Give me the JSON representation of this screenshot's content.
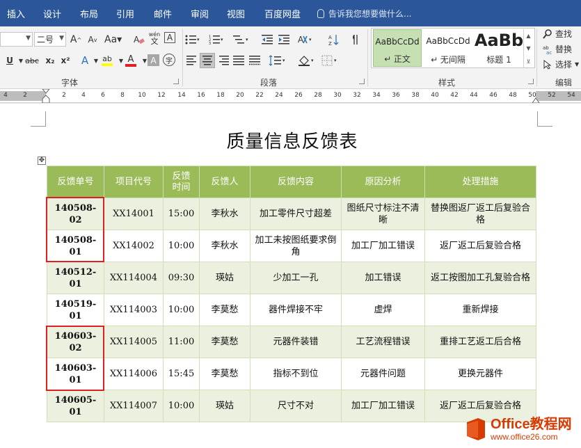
{
  "ribbon_tabs": [
    "插入",
    "设计",
    "布局",
    "引用",
    "邮件",
    "审阅",
    "视图",
    "百度网盘"
  ],
  "tell_me": "告诉我您想要做什么...",
  "font": {
    "size_value": "二号",
    "grow_label": "A",
    "shrink_label": "A",
    "underline": "U",
    "strike": "abc",
    "subscript": "x₂",
    "superscript": "x²",
    "text_effect": "A",
    "highlight": "ab",
    "font_color": "A",
    "char_shade": "A",
    "enclose": "字",
    "phonetic": "wén",
    "border_char": "A",
    "group_label": "字体"
  },
  "paragraph": {
    "group_label": "段落"
  },
  "styles": {
    "items": [
      {
        "sample": "AaBbCcDd",
        "name": "↵ 正文"
      },
      {
        "sample": "AaBbCcDd",
        "name": "↵ 无间隔"
      },
      {
        "sample": "AaBb",
        "name": "标题 1"
      }
    ],
    "group_label": "样式"
  },
  "editing": {
    "find": "查找",
    "replace": "替换",
    "select": "选择",
    "group_label": "编辑"
  },
  "ruler_numbers": [
    "4",
    "2",
    "2",
    "4",
    "6",
    "8",
    "10",
    "12",
    "14",
    "16",
    "18",
    "20",
    "22",
    "24",
    "26",
    "28",
    "30",
    "32",
    "34",
    "36",
    "38",
    "40",
    "42",
    "44",
    "46",
    "48",
    "50",
    "52",
    "54"
  ],
  "document": {
    "title": "质量信息反馈表",
    "table": {
      "headers": [
        "反馈单号",
        "项目代号",
        "反馈\n时间",
        "反馈人",
        "反馈内容",
        "原因分析",
        "处理措施"
      ],
      "rows": [
        [
          "140508-02",
          "XX14001",
          "15:00",
          "李秋水",
          "加工零件尺寸超差",
          "图纸尺寸标注不清晰",
          "替换图返厂返工后复验合格"
        ],
        [
          "140508-01",
          "XX14002",
          "10:00",
          "李秋水",
          "加工未按图纸要求倒角",
          "加工厂加工错误",
          "返厂返工后复验合格"
        ],
        [
          "140512-01",
          "XX114004",
          "09:30",
          "瑛姑",
          "少加工一孔",
          "加工错误",
          "返工按图加工孔复验合格"
        ],
        [
          "140519-01",
          "XX114003",
          "10:00",
          "李莫愁",
          "器件焊接不牢",
          "虚焊",
          "重新焊接"
        ],
        [
          "140603-02",
          "XX114005",
          "11:00",
          "李莫愁",
          "元器件装错",
          "工艺流程错误",
          "重排工艺返工后合格"
        ],
        [
          "140603-01",
          "XX114006",
          "15:45",
          "李莫愁",
          "指标不到位",
          "元器件问题",
          "更换元器件"
        ],
        [
          "140605-01",
          "XX114007",
          "10:00",
          "瑛姑",
          "尺寸不对",
          "加工厂加工错误",
          "返厂返工后复验合格"
        ]
      ]
    }
  },
  "watermark": {
    "line1": "Office教程网",
    "line2": "www.office26.com"
  },
  "colors": {
    "ribbon_blue": "#2b579a",
    "header_green": "#9bbb59",
    "band_green": "#ebf1de",
    "highlight_red": "#e02020",
    "watermark_orange": "#d83b01"
  }
}
